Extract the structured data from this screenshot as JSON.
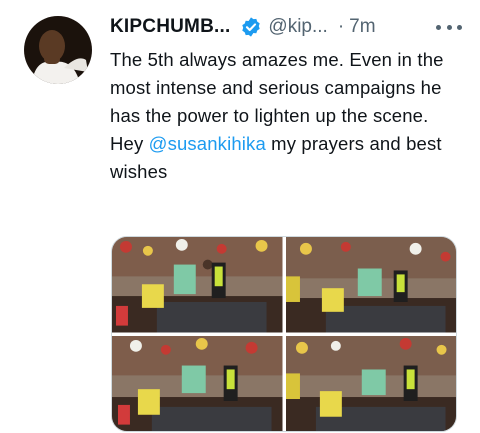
{
  "tweet": {
    "author": {
      "display_name": "KIPCHUMB...",
      "handle": "@kip...",
      "verified_icon": "verified-badge-icon"
    },
    "separator": "·",
    "time": "7m",
    "more_icon": "more-options-icon",
    "text_before_mention": "The 5th always amazes me. Even in the most intense and serious campaigns he has the power to lighten up the scene. Hey ",
    "mention": "@susankihika",
    "text_after_mention": " my prayers and best wishes",
    "media": {
      "photo_count": 4
    }
  },
  "colors": {
    "accent": "#1d9bf0",
    "secondary_text": "#536471",
    "primary_text": "#0f1419"
  }
}
